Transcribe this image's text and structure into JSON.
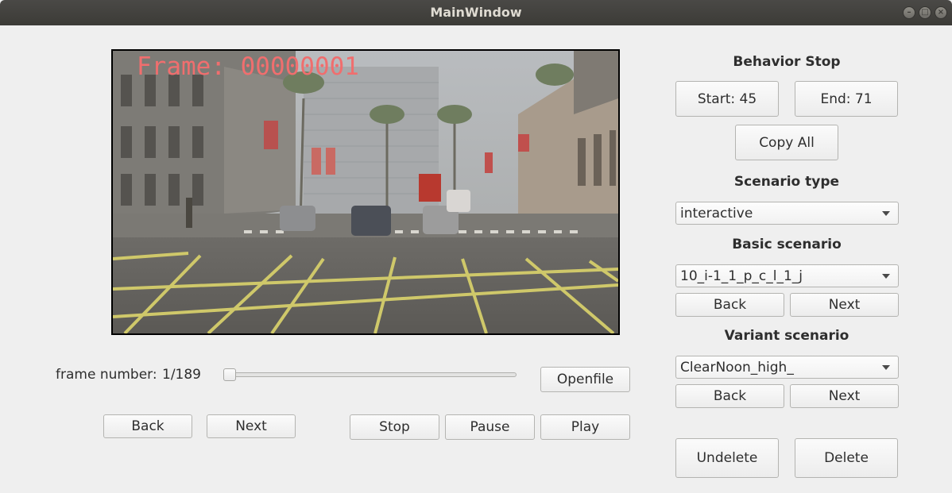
{
  "window": {
    "title": "MainWindow"
  },
  "video": {
    "frame_overlay": "Frame: 00000001"
  },
  "playback": {
    "frame_number_label": "frame number:",
    "frame_counter": "1/189",
    "progress": 0.0,
    "openfile_label": "Openfile",
    "back_label": "Back",
    "next_label": "Next",
    "stop_label": "Stop",
    "pause_label": "Pause",
    "play_label": "Play"
  },
  "behavior_stop": {
    "heading": "Behavior Stop",
    "start_label": "Start:  45",
    "end_label": "End:  71",
    "copy_all_label": "Copy All"
  },
  "scenario_type": {
    "heading": "Scenario type",
    "selected": "interactive"
  },
  "basic_scenario": {
    "heading": "Basic scenario",
    "selected": "10_i-1_1_p_c_l_1_j",
    "back_label": "Back",
    "next_label": "Next"
  },
  "variant_scenario": {
    "heading": "Variant scenario",
    "selected": "ClearNoon_high_",
    "back_label": "Back",
    "next_label": "Next"
  },
  "actions": {
    "undelete_label": "Undelete",
    "delete_label": "Delete"
  },
  "icons": {
    "minimize": "minimize-icon",
    "maximize": "maximize-icon",
    "close": "close-icon",
    "dropdown": "chevron-down-icon"
  }
}
